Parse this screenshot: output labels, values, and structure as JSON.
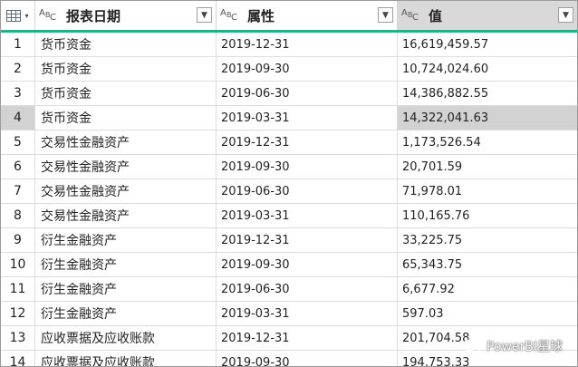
{
  "header": {
    "col1_title": "报表日期",
    "col2_title": "属性",
    "col3_title": "值",
    "type_icon": "ABC-text-type-icon",
    "dropdown_glyph": "▼",
    "table_menu_glyph": "▾"
  },
  "rows": [
    {
      "n": "1",
      "name": "货币资金",
      "date": "2019-12-31",
      "value": "16,619,459.57"
    },
    {
      "n": "2",
      "name": "货币资金",
      "date": "2019-09-30",
      "value": "10,724,024.60"
    },
    {
      "n": "3",
      "name": "货币资金",
      "date": "2019-06-30",
      "value": "14,386,882.55"
    },
    {
      "n": "4",
      "name": "货币资金",
      "date": "2019-03-31",
      "value": "14,322,041.63"
    },
    {
      "n": "5",
      "name": "交易性金融资产",
      "date": "2019-12-31",
      "value": "1,173,526.54"
    },
    {
      "n": "6",
      "name": "交易性金融资产",
      "date": "2019-09-30",
      "value": "20,701.59"
    },
    {
      "n": "7",
      "name": "交易性金融资产",
      "date": "2019-06-30",
      "value": "71,978.01"
    },
    {
      "n": "8",
      "name": "交易性金融资产",
      "date": "2019-03-31",
      "value": "110,165.76"
    },
    {
      "n": "9",
      "name": "衍生金融资产",
      "date": "2019-12-31",
      "value": "33,225.75"
    },
    {
      "n": "10",
      "name": "衍生金融资产",
      "date": "2019-09-30",
      "value": "65,343.75"
    },
    {
      "n": "11",
      "name": "衍生金融资产",
      "date": "2019-06-30",
      "value": "6,677.92"
    },
    {
      "n": "12",
      "name": "衍生金融资产",
      "date": "2019-03-31",
      "value": "597.03"
    },
    {
      "n": "13",
      "name": "应收票据及应收账款",
      "date": "2019-12-31",
      "value": "201,704.58"
    },
    {
      "n": "14",
      "name": "应收票据及应收账款",
      "date": "2019-09-30",
      "value": "194,753.33"
    }
  ],
  "selected_row": 4,
  "watermark": "PowerBI星球",
  "colors": {
    "accent": "#1fb08c",
    "selected": "#d2d2d2",
    "header_selected": "#d9d9d9"
  }
}
